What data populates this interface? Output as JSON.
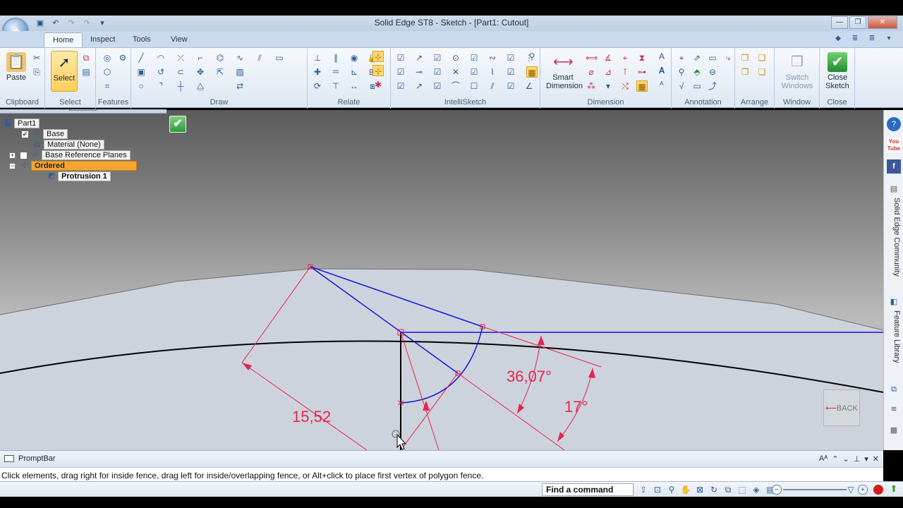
{
  "window": {
    "title": "Solid Edge ST8 - Sketch - [Part1: Cutout]"
  },
  "quick_access": [
    "save-icon",
    "undo-icon",
    "redo-icon",
    "customize-icon"
  ],
  "tabs": [
    {
      "label": "Home",
      "active": true
    },
    {
      "label": "Inspect",
      "active": false
    },
    {
      "label": "Tools",
      "active": false
    },
    {
      "label": "View",
      "active": false
    }
  ],
  "ribbon": {
    "groups": {
      "clipboard": "Clipboard",
      "select": "Select",
      "features": "Features",
      "draw": "Draw",
      "relate": "Relate",
      "intellisketch": "IntelliSketch",
      "dimension": "Dimension",
      "annotation": "Annotation",
      "arrange": "Arrange",
      "window": "Window",
      "close": "Close"
    },
    "buttons": {
      "paste": "Paste",
      "select": "Select",
      "smart_dimension_line1": "Smart",
      "smart_dimension_line2": "Dimension",
      "switch_windows_line1": "Switch",
      "switch_windows_line2": "Windows",
      "close_sketch_line1": "Close",
      "close_sketch_line2": "Sketch"
    }
  },
  "pathfinder": {
    "part": "Part1",
    "base": "Base",
    "material": "Material (None)",
    "ref_planes": "Base Reference Planes",
    "ordered": "Ordered",
    "protrusion": "Protrusion 1"
  },
  "sketch": {
    "dim_length": "15,52",
    "dim_angle1": "36,07°",
    "dim_angle2": "17°",
    "colors": {
      "geometry": "#1515d8",
      "dimension": "#e8234f",
      "edge": "#000000"
    }
  },
  "back_button": "BACK",
  "right_panel": {
    "community": "Solid Edge Community",
    "feature_library": "Feature Library"
  },
  "promptbar": {
    "title": "PromptBar",
    "message": "Click elements, drag right for inside fence, drag left for inside/overlapping fence, or Alt+click to place first vertex of polygon fence."
  },
  "statusbar": {
    "find_command": "Find a command"
  }
}
